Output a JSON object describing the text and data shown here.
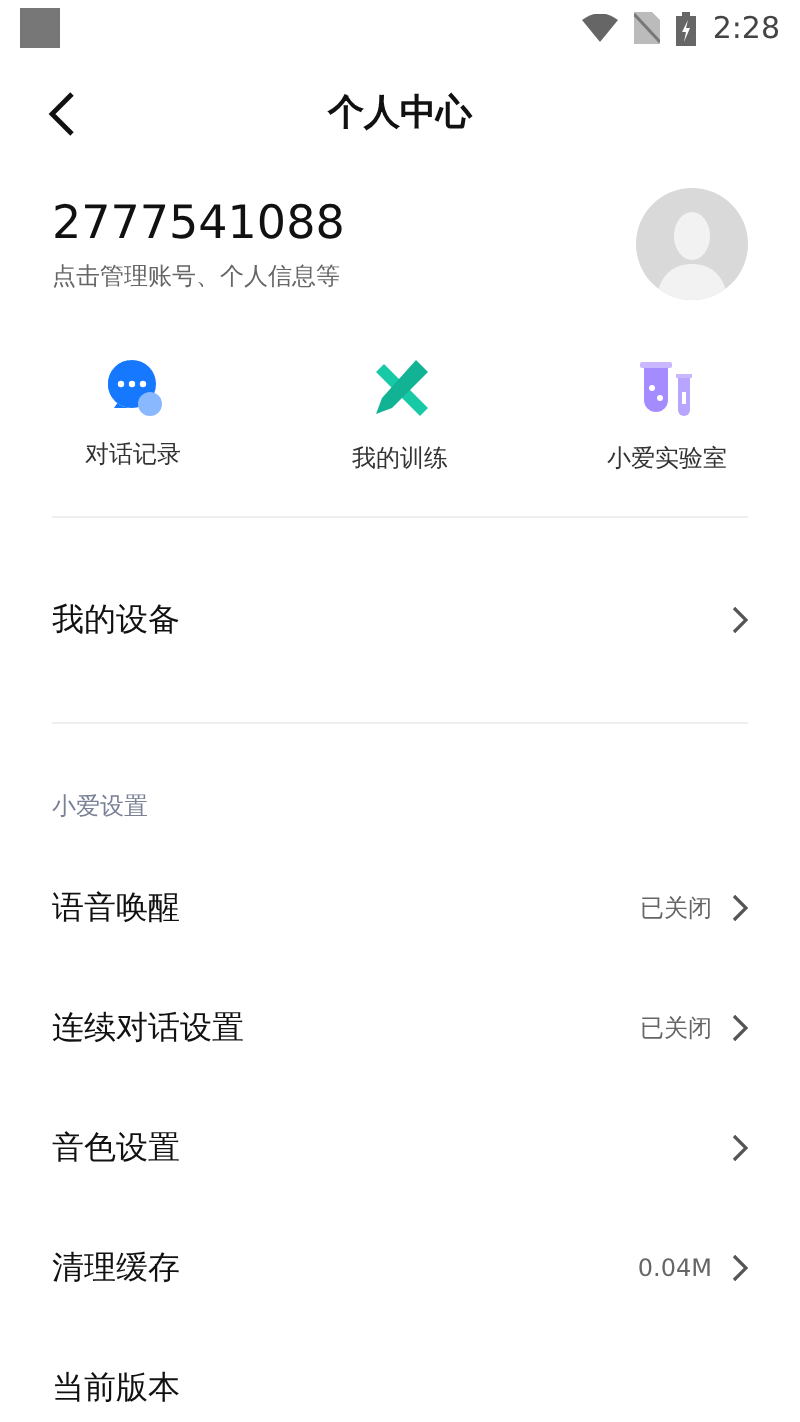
{
  "status_bar": {
    "time": "2:28"
  },
  "header": {
    "title": "个人中心"
  },
  "account": {
    "id": "2777541088",
    "subtitle": "点击管理账号、个人信息等"
  },
  "shortcuts": [
    {
      "kind": "chat",
      "label": "对话记录"
    },
    {
      "kind": "training",
      "label": "我的训练"
    },
    {
      "kind": "lab",
      "label": "小爱实验室"
    }
  ],
  "devices_row": {
    "label": "我的设备"
  },
  "settings": {
    "section_title": "小爱设置",
    "rows": [
      {
        "label": "语音唤醒",
        "value": "已关闭"
      },
      {
        "label": "连续对话设置",
        "value": "已关闭"
      },
      {
        "label": "音色设置"
      },
      {
        "label": "清理缓存",
        "value": "0.04M"
      },
      {
        "label": "当前版本",
        "chevron": false
      }
    ]
  }
}
